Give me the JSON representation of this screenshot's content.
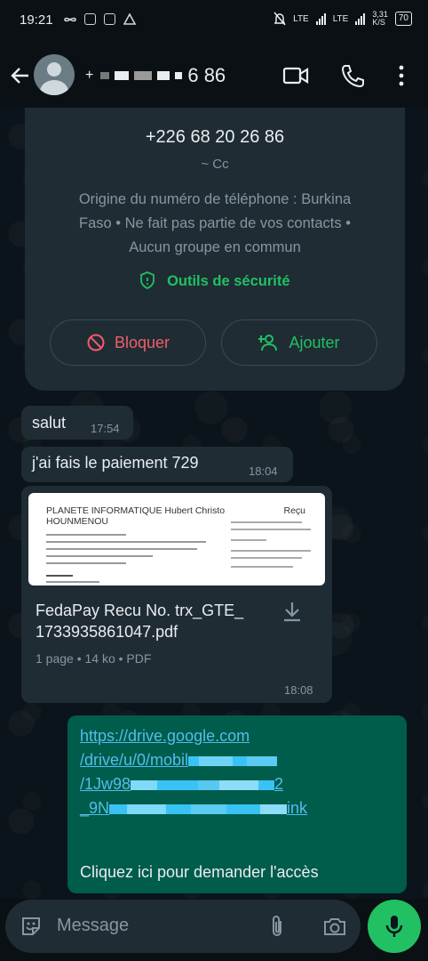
{
  "status_bar": {
    "time": "19:21",
    "net_left": "LTE",
    "net_right": "LTE",
    "speed_value": "3,31",
    "speed_unit": "K/S",
    "battery": "70"
  },
  "header": {
    "name_suffix": "6 86"
  },
  "info_card": {
    "phone": "+226 68 20 26 86",
    "alias": "~ Cc",
    "origin_line1": "Origine du numéro de téléphone : Burkina",
    "origin_line2": "Faso • Ne fait pas partie de vos contacts •",
    "origin_line3": "Aucun groupe en commun",
    "security_tools": "Outils de sécurité",
    "block_label": "Bloquer",
    "add_label": "Ajouter"
  },
  "messages": [
    {
      "text": "salut",
      "time": "17:54"
    },
    {
      "text": "j'ai fais le paiement 729",
      "time": "18:04"
    }
  ],
  "document": {
    "preview_title_line1": "PLANETE INFORMATIQUE Hubert Christo",
    "preview_title_line2": "HOUNMENOU",
    "preview_right": "Reçu",
    "filename_line1": "FedaPay Recu No. trx_GTE_",
    "filename_line2": "1733935861047.pdf",
    "meta": "1 page • 14 ko • PDF",
    "time": "18:08"
  },
  "outgoing": {
    "link_line1": "https://drive.google.com",
    "link_line2_visible": "/drive/u/0/mobil",
    "link_line3_visible": "/1Jw98",
    "link_line3_tail": "2",
    "link_line4_visible": "_9N",
    "link_line4_tail": "ink",
    "request_access": "Cliquez ici pour demander l'accès"
  },
  "composer": {
    "placeholder": "Message"
  },
  "colors": {
    "accent_green": "#21c063",
    "bubble_in": "#1f2c34",
    "bubble_out": "#005c4b",
    "link": "#53bdeb",
    "danger": "#f15c6d"
  }
}
